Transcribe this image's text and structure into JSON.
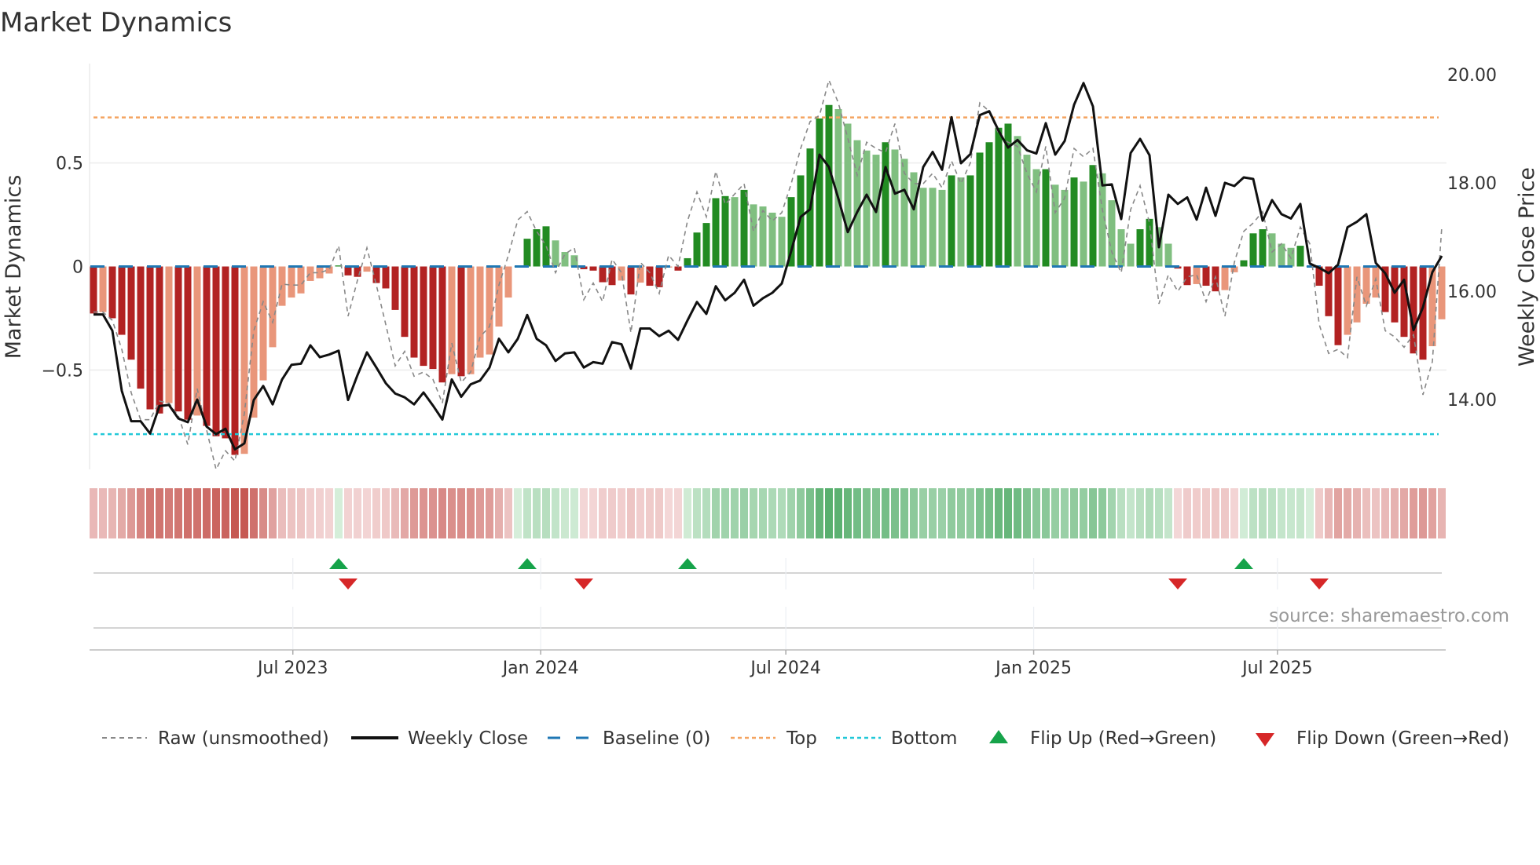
{
  "chart_data": {
    "type": "bar",
    "title": "Market Dynamics",
    "ylabel": "Market Dynamics",
    "ylabel_right": "Weekly Close Price",
    "start_date": "2023-02-03",
    "frequency": "weekly",
    "ylim": [
      -0.98,
      0.98
    ],
    "ylim_right": [
      12.71,
      20.2
    ],
    "yticks": [
      {
        "value": 0.5,
        "label": "0.5"
      },
      {
        "value": 0,
        "label": "0"
      },
      {
        "value": -0.5,
        "label": "−0.5"
      }
    ],
    "yticks_right": [
      {
        "value": 20,
        "label": "20.00"
      },
      {
        "value": 18,
        "label": "18.00"
      },
      {
        "value": 16,
        "label": "16.00"
      },
      {
        "value": 14,
        "label": "14.00"
      }
    ],
    "xticks": [
      {
        "date": "2023-07-01",
        "label": "Jul 2023"
      },
      {
        "date": "2024-01-01",
        "label": "Jan 2024"
      },
      {
        "date": "2024-07-01",
        "label": "Jul 2024"
      },
      {
        "date": "2025-01-01",
        "label": "Jan 2025"
      },
      {
        "date": "2025-07-01",
        "label": "Jul 2025"
      }
    ],
    "grid": true,
    "levels": {
      "top": 0.72,
      "bottom": -0.81,
      "baseline": 0
    },
    "momentum": [
      -0.227,
      -0.22,
      -0.25,
      -0.33,
      -0.45,
      -0.59,
      -0.69,
      -0.71,
      -0.66,
      -0.7,
      -0.74,
      -0.72,
      -0.77,
      -0.82,
      -0.83,
      -0.91,
      -0.905,
      -0.73,
      -0.55,
      -0.39,
      -0.19,
      -0.15,
      -0.13,
      -0.07,
      -0.057,
      -0.034,
      0.005,
      -0.043,
      -0.05,
      -0.025,
      -0.08,
      -0.106,
      -0.21,
      -0.34,
      -0.44,
      -0.48,
      -0.495,
      -0.56,
      -0.52,
      -0.53,
      -0.52,
      -0.44,
      -0.425,
      -0.29,
      -0.15,
      0,
      0.134,
      0.18,
      0.194,
      0.126,
      0.07,
      0.054,
      -0.013,
      -0.02,
      -0.076,
      -0.09,
      -0.068,
      -0.135,
      -0.078,
      -0.093,
      -0.1,
      -0.005,
      -0.02,
      0.04,
      0.164,
      0.21,
      0.33,
      0.34,
      0.335,
      0.37,
      0.3,
      0.29,
      0.26,
      0.24,
      0.335,
      0.44,
      0.57,
      0.715,
      0.78,
      0.76,
      0.69,
      0.61,
      0.56,
      0.54,
      0.6,
      0.565,
      0.52,
      0.455,
      0.38,
      0.38,
      0.37,
      0.44,
      0.43,
      0.44,
      0.55,
      0.6,
      0.67,
      0.69,
      0.63,
      0.54,
      0.47,
      0.47,
      0.395,
      0.37,
      0.43,
      0.41,
      0.49,
      0.45,
      0.32,
      0.18,
      0.11,
      0.18,
      0.23,
      0.19,
      0.11,
      -0.01,
      -0.09,
      -0.085,
      -0.093,
      -0.12,
      -0.114,
      -0.028,
      0.03,
      0.16,
      0.18,
      0.16,
      0.11,
      0.09,
      0.1,
      0,
      -0.093,
      -0.24,
      -0.38,
      -0.33,
      -0.27,
      -0.18,
      -0.15,
      -0.22,
      -0.27,
      -0.34,
      -0.42,
      -0.45,
      -0.385,
      -0.255
    ],
    "shade": "DLDDDDDDLDDLDDDDLLLLLLLLLLDDDLDDDDDDDDLDLLLLLLDDDLLLDDDDLDLDDLDDDDDDLDLLLLDDDDDLLLLLDLLLLLLDLDDDDDLLLDLLDLDLLLLDDLLDDLDDLLDDDLLLDLDDDLLLLDDDDDLL",
    "raw": [
      -0.22,
      -0.22,
      -0.26,
      -0.4,
      -0.61,
      -0.74,
      -0.74,
      -0.65,
      -0.66,
      -0.72,
      -0.86,
      -0.59,
      -0.79,
      -0.98,
      -0.89,
      -0.94,
      -0.71,
      -0.31,
      -0.17,
      -0.27,
      -0.085,
      -0.09,
      -0.09,
      -0.03,
      -0.03,
      -0.015,
      0.1,
      -0.24,
      -0.066,
      0.09,
      -0.09,
      -0.28,
      -0.48,
      -0.41,
      -0.53,
      -0.51,
      -0.545,
      -0.66,
      -0.37,
      -0.56,
      -0.51,
      -0.34,
      -0.29,
      -0.09,
      0.054,
      0.225,
      0.265,
      0.17,
      0.1,
      -0.03,
      0.06,
      0.09,
      -0.16,
      -0.08,
      -0.17,
      0.035,
      -0.03,
      -0.32,
      0.02,
      -0.03,
      -0.13,
      0.054,
      0,
      0.22,
      0.36,
      0.24,
      0.46,
      0.3,
      0.35,
      0.4,
      0.17,
      0.27,
      0.22,
      0.26,
      0.4,
      0.57,
      0.7,
      0.73,
      0.9,
      0.79,
      0.62,
      0.44,
      0.6,
      0.57,
      0.55,
      0.69,
      0.45,
      0.4,
      0.4,
      0.45,
      0.38,
      0.51,
      0.4,
      0.5,
      0.79,
      0.75,
      0.64,
      0.6,
      0.58,
      0.45,
      0.36,
      0.58,
      0.26,
      0.33,
      0.57,
      0.53,
      0.57,
      0.275,
      0.07,
      -0.03,
      0.275,
      0.39,
      0.21,
      -0.18,
      -0.04,
      -0.12,
      -0.05,
      -0.04,
      -0.17,
      -0.05,
      -0.24,
      0.02,
      0.17,
      0.21,
      0.265,
      0.07,
      0.11,
      0.04,
      0.19,
      0.11,
      -0.28,
      -0.42,
      -0.4,
      -0.44,
      -0.05,
      -0.19,
      -0.06,
      -0.31,
      -0.34,
      -0.39,
      -0.33,
      -0.62,
      -0.46,
      0.19
    ],
    "close": [
      15.57,
      15.57,
      15.27,
      14.16,
      13.6,
      13.6,
      13.37,
      13.88,
      13.9,
      13.65,
      13.58,
      14.0,
      13.5,
      13.36,
      13.46,
      13.08,
      13.19,
      13.99,
      14.25,
      13.91,
      14.37,
      14.64,
      14.66,
      15.0,
      14.78,
      14.83,
      14.9,
      13.99,
      14.45,
      14.87,
      14.59,
      14.3,
      14.11,
      14.04,
      13.91,
      14.13,
      13.89,
      13.63,
      14.37,
      14.05,
      14.28,
      14.35,
      14.59,
      15.12,
      14.87,
      15.12,
      15.56,
      15.12,
      15.0,
      14.71,
      14.85,
      14.87,
      14.59,
      14.69,
      14.66,
      15.06,
      15.02,
      14.57,
      15.31,
      15.31,
      15.17,
      15.27,
      15.1,
      15.46,
      15.8,
      15.58,
      16.09,
      15.83,
      15.97,
      16.21,
      15.73,
      15.87,
      15.97,
      16.14,
      16.74,
      17.37,
      17.51,
      18.52,
      18.29,
      17.71,
      17.09,
      17.46,
      17.78,
      17.46,
      18.29,
      17.8,
      17.87,
      17.51,
      18.29,
      18.57,
      18.24,
      19.21,
      18.36,
      18.53,
      19.25,
      19.32,
      18.96,
      18.65,
      18.79,
      18.6,
      18.54,
      19.1,
      18.52,
      18.77,
      19.44,
      19.84,
      19.41,
      17.95,
      17.97,
      17.33,
      18.55,
      18.81,
      18.51,
      16.81,
      17.78,
      17.61,
      17.73,
      17.32,
      17.91,
      17.39,
      18.0,
      17.94,
      18.1,
      18.07,
      17.3,
      17.68,
      17.42,
      17.34,
      17.61,
      16.51,
      16.43,
      16.33,
      16.49,
      17.18,
      17.28,
      17.42,
      16.52,
      16.33,
      15.97,
      16.21,
      15.28,
      15.7,
      16.35,
      16.65
    ],
    "flips_up_week": [
      27,
      47,
      64,
      123
    ],
    "flips_down_week": [
      28,
      53,
      116,
      131
    ],
    "colors": {
      "neg_strong": "#b22222",
      "neg_weak": "#e9967a",
      "pos_strong": "#228b22",
      "pos_weak": "#80bf80",
      "raw": "#888888",
      "close": "#111111",
      "baseline": "#1f77b4",
      "top": "#f4a460",
      "bottom": "#22c8d8",
      "flip_up": "#16a34a",
      "flip_down": "#d62728"
    },
    "legend": {
      "position": "bottom",
      "raw": "Raw (unsmoothed)",
      "close": "Weekly Close",
      "baseline": "Baseline (0)",
      "top": "Top",
      "bottom": "Bottom",
      "flip_up": "Flip Up (Red→Green)",
      "flip_down": "Flip Down (Green→Red)"
    },
    "source": "source: sharemaestro.com"
  }
}
